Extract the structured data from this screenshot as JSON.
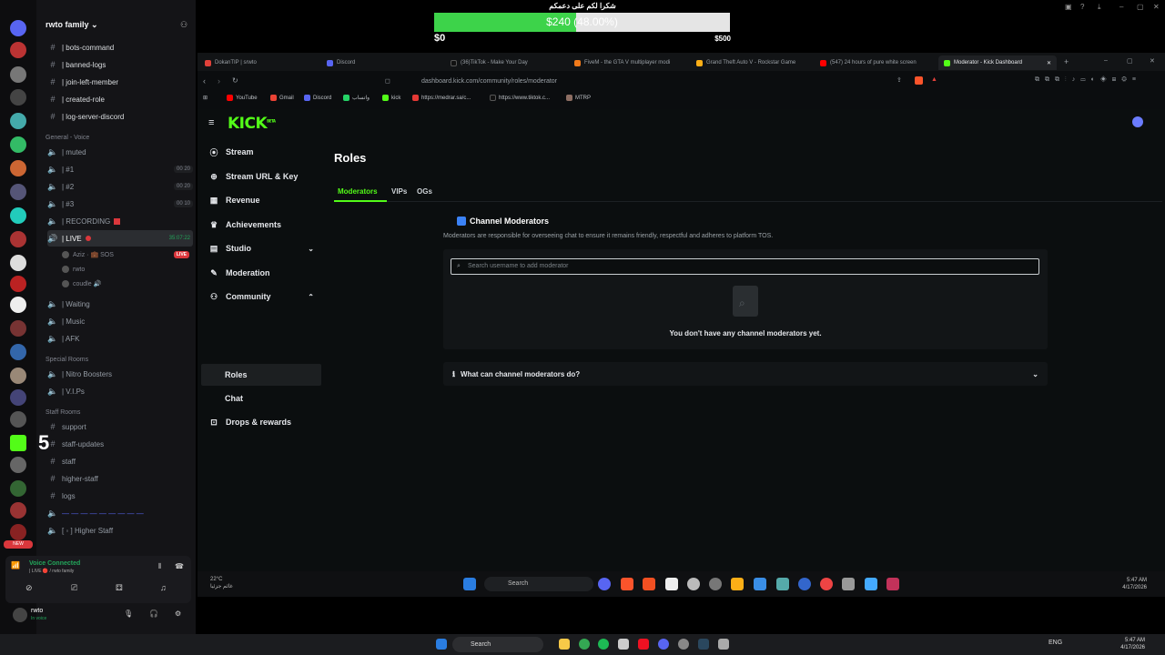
{
  "donation": {
    "title": "شكرا لكم على دعمكم",
    "amount_label": "$240 (48.00%)",
    "progress_fraction": 0.48,
    "min_label": "$0",
    "max_label": "$500"
  },
  "discord": {
    "server_name": "rwto family",
    "text_channels": [
      "| bots-command",
      "| banned-logs",
      "| join-left-member",
      "| created-role",
      "| log-server-discord"
    ],
    "voice_category": "General - Voice",
    "voice_channels": [
      {
        "name": "| muted",
        "count": ""
      },
      {
        "name": "| #1",
        "count": "00 20"
      },
      {
        "name": "| #2",
        "count": "00 20"
      },
      {
        "name": "| #3",
        "count": "00 10"
      },
      {
        "name": "| RECORDING",
        "count": ""
      },
      {
        "name": "| LIVE",
        "count": "35:07:22"
      }
    ],
    "live_members": [
      {
        "name": "Aziz · 💼 SOS",
        "badge": "LIVE"
      },
      {
        "name": "rwto",
        "badge": ""
      },
      {
        "name": "coudle 🔊",
        "badge": ""
      }
    ],
    "other_voice": [
      "| Waiting",
      "| Music",
      "| AFK"
    ],
    "special_category": "Special Rooms",
    "special_channels": [
      "| Nitro Boosters",
      "| V.I.Ps"
    ],
    "staff_category": "Staff Rooms",
    "staff_channels": [
      "support",
      "staff-updates",
      "staff",
      "higher-staff",
      "logs",
      "— — — — — — — — —",
      "[ ◦ ] Higher Staff"
    ],
    "big_number": "5",
    "new_badge": "NEW",
    "voice_connected": "Voice Connected",
    "voice_sub": "| LIVE 🔴 / rwto family",
    "user_name": "rwto",
    "user_status": "In voice"
  },
  "browser": {
    "tabs": [
      {
        "label": "DokanTIP | srwto",
        "color": "#e0413a"
      },
      {
        "label": "Discord",
        "color": "#5865f2"
      },
      {
        "label": "(36)TikTok - Make Your Day",
        "color": "#111111"
      },
      {
        "label": "FiveM - the GTA V multiplayer modi",
        "color": "#f07a1a"
      },
      {
        "label": "Grand Theft Auto V - Rockstar Game",
        "color": "#fcaf17"
      },
      {
        "label": "(547) 24 hours of pure white screen",
        "color": "#ff0000"
      },
      {
        "label": "Moderator - Kick Dashboard",
        "color": "#53fc18"
      }
    ],
    "url": "dashboard.kick.com/community/roles/moderator",
    "bookmarks": [
      {
        "label": "YouTube",
        "color": "#ff0000"
      },
      {
        "label": "Gmail",
        "color": "#ea4335"
      },
      {
        "label": "Discord",
        "color": "#5865f2"
      },
      {
        "label": "واتساب",
        "color": "#25d366"
      },
      {
        "label": "kick",
        "color": "#53fc18"
      },
      {
        "label": "https://medrar.sa/c...",
        "color": "#e53935"
      },
      {
        "label": "https://www.tiktok.c...",
        "color": "#111111"
      },
      {
        "label": "MTRP",
        "color": "#8d6e63"
      }
    ]
  },
  "kick": {
    "logo": "KICK",
    "logo_badge": "BETA",
    "nav": [
      {
        "label": "Stream",
        "icon": "stream-icon"
      },
      {
        "label": "Stream URL & Key",
        "icon": "globe-icon"
      },
      {
        "label": "Revenue",
        "icon": "revenue-icon"
      },
      {
        "label": "Achievements",
        "icon": "trophy-icon"
      },
      {
        "label": "Studio",
        "icon": "studio-icon"
      },
      {
        "label": "Moderation",
        "icon": "wrench-icon"
      },
      {
        "label": "Community",
        "icon": "people-icon"
      },
      {
        "label": "Roles",
        "icon": ""
      },
      {
        "label": "Chat",
        "icon": ""
      },
      {
        "label": "Drops & rewards",
        "icon": "gift-icon"
      }
    ],
    "page_title": "Roles",
    "subtabs": [
      "Moderators",
      "VIPs",
      "OGs"
    ],
    "section_title": "Channel Moderators",
    "section_desc": "Moderators are responsible for overseeing chat to ensure it remains friendly, respectful and adheres to platform TOS.",
    "search_placeholder": "Search username to add moderator",
    "empty_text": "You don't have any channel moderators yet.",
    "faq_label": "What can channel moderators do?"
  },
  "taskbar": {
    "search_label": "Search",
    "weather_temp": "22°C",
    "weather_desc": "غائم جزئيا",
    "inner_time": "5:47 AM",
    "inner_date": "4/17/2026",
    "lang": "ENG",
    "outer_time": "5:47 AM",
    "outer_date": "4/17/2026"
  }
}
